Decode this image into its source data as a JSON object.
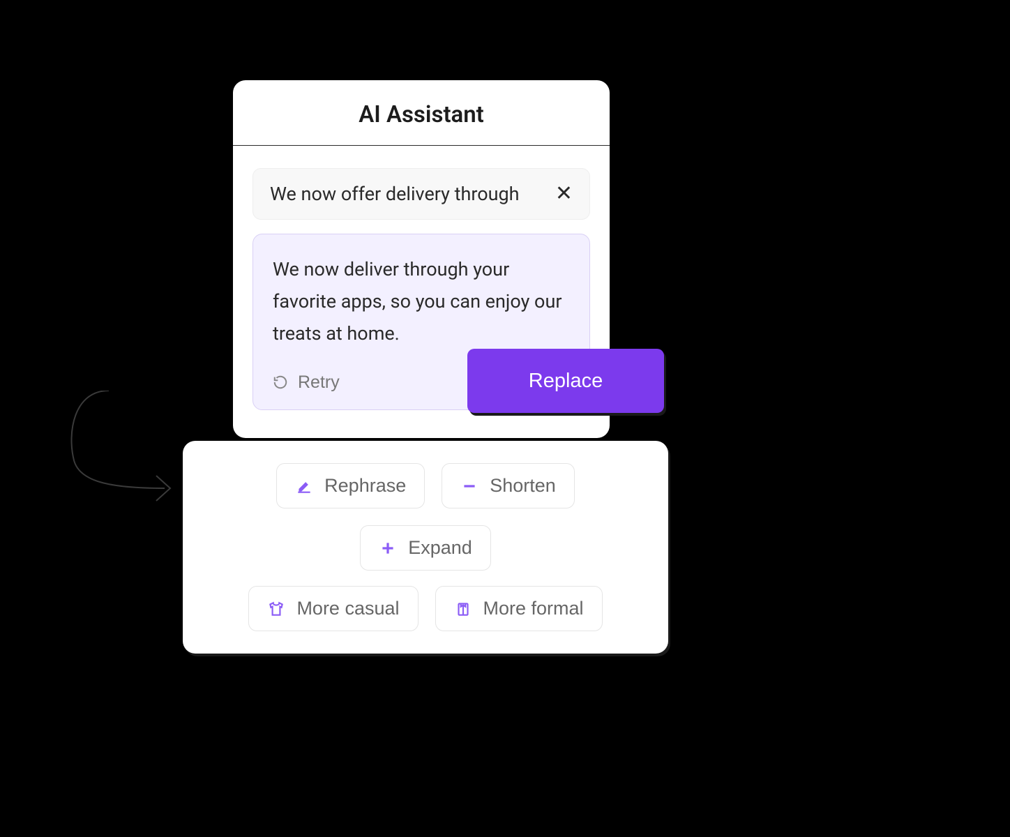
{
  "panel": {
    "title": "AI Assistant",
    "input_text": "We now offer delivery through",
    "suggestion_text": "We now deliver through your favorite apps, so you can enjoy our treats at home.",
    "retry_label": "Retry",
    "replace_label": "Replace"
  },
  "actions": {
    "rephrase": "Rephrase",
    "shorten": "Shorten",
    "expand": "Expand",
    "more_casual": "More casual",
    "more_formal": "More formal"
  },
  "colors": {
    "accent": "#7c3aed",
    "suggestion_bg": "#f3f0ff"
  }
}
